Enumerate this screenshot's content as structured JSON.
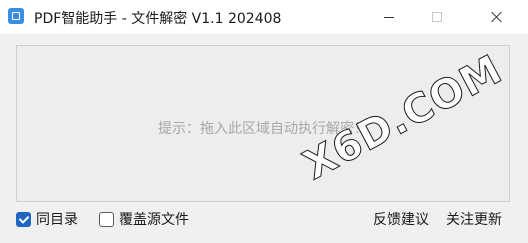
{
  "window": {
    "title": "PDF智能助手 - 文件解密 V1.1 202408"
  },
  "dropzone": {
    "hint": "提示：拖入此区域自动执行解密！"
  },
  "watermark": "X6D.COM",
  "options": {
    "same_dir": {
      "label": "同目录",
      "checked": true
    },
    "overwrite_source": {
      "label": "覆盖源文件",
      "checked": false
    }
  },
  "links": {
    "feedback": "反馈建议",
    "follow_update": "关注更新"
  },
  "colors": {
    "accent": "#1f66c2",
    "app_icon": "#3a8ee6"
  }
}
